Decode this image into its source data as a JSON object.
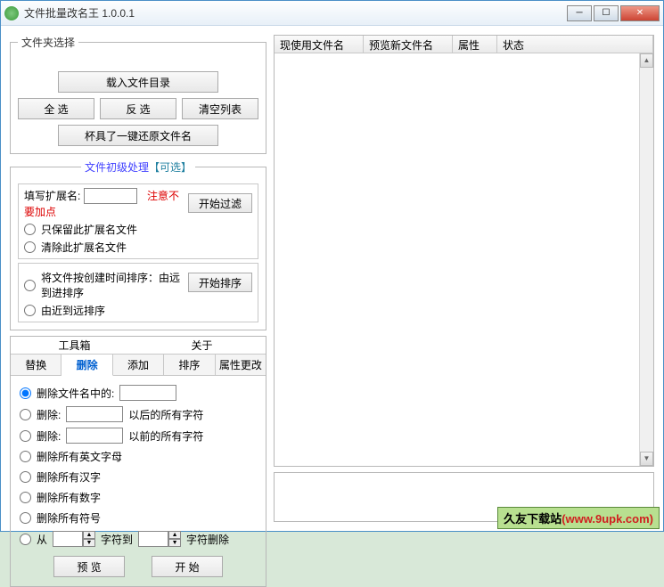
{
  "window": {
    "title": "文件批量改名王  1.0.0.1"
  },
  "folder": {
    "legend": "文件夹选择",
    "load": "载入文件目录",
    "select_all": "全 选",
    "invert": "反 选",
    "clear": "清空列表",
    "restore": "杯具了一键还原文件名"
  },
  "prep": {
    "head1": "文件初级处理",
    "head2": "【可选】",
    "ext_label": "填写扩展名:",
    "ext_warn": "注意不要加点",
    "keep_ext": "只保留此扩展名文件",
    "clear_ext": "清除此扩展名文件",
    "start_filter": "开始过滤",
    "sort_by_time": "将文件按创建时间排序：由远到进排序",
    "sort_near": "由近到远排序",
    "start_sort": "开始排序"
  },
  "tabs_top": {
    "toolbox": "工具箱",
    "about": "关于"
  },
  "tabs": {
    "replace": "替换",
    "delete": "删除",
    "add": "添加",
    "sort": "排序",
    "attr": "属性更改"
  },
  "delete_tab": {
    "r1": "删除文件名中的:",
    "r2a": "删除:",
    "r2b": "以后的所有字符",
    "r3a": "删除:",
    "r3b": "以前的所有字符",
    "r4": "删除所有英文字母",
    "r5": "删除所有汉字",
    "r6": "删除所有数字",
    "r7": "删除所有符号",
    "r8a": "从",
    "r8b": "字符到",
    "r8c": "字符删除",
    "preview": "预 览",
    "start": "开 始"
  },
  "list": {
    "cols": [
      "现使用文件名",
      "预览新文件名",
      "属性",
      "状态"
    ]
  },
  "watermark": {
    "site": "久友下载站",
    "url": "(www.9upk.com)"
  }
}
